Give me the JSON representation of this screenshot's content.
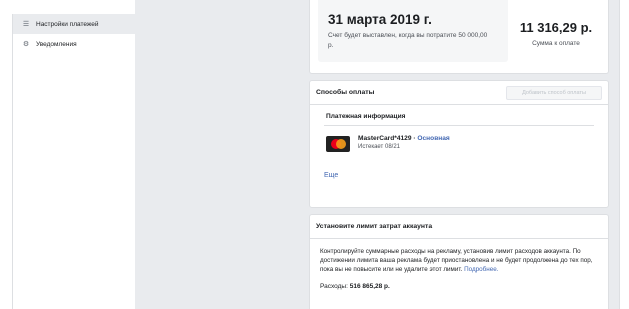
{
  "sidebar": {
    "items": [
      {
        "icon": "list-icon",
        "label": "Настройки платежей",
        "active": true
      },
      {
        "icon": "gear-icon",
        "label": "Уведомления",
        "active": false
      }
    ]
  },
  "billing": {
    "date": "31 марта 2019 г.",
    "note": "Счет будет выставлен, когда вы потратите 50 000,00 р.",
    "amount": "11 316,29 р.",
    "amount_label": "Сумма к оплате"
  },
  "payment": {
    "title": "Способы оплаты",
    "add_button": "Добавить способ оплаты",
    "section_title": "Платежная информация",
    "card_name": "MasterCard*4129",
    "separator": " · ",
    "primary_label": "Основная",
    "expires": "Истекает 08/21",
    "more": "Еще"
  },
  "limit": {
    "title": "Установите лимит затрат аккаунта",
    "description": "Контролируйте суммарные расходы на рекламу, установив лимит расходов аккаунта. По достижении лимита ваша реклама будет приостановлена и не будет продолжена до тех пор, пока вы не повысите или не удалите этот лимит.",
    "more_link": "Подробнее.",
    "spent_label": "Расходы:",
    "spent_value": "516 865,28 р."
  },
  "colors": {
    "accent": "#4267b2",
    "background": "#e9ebee",
    "mastercard_red": "#eb001b",
    "mastercard_orange": "#f79e1b"
  }
}
